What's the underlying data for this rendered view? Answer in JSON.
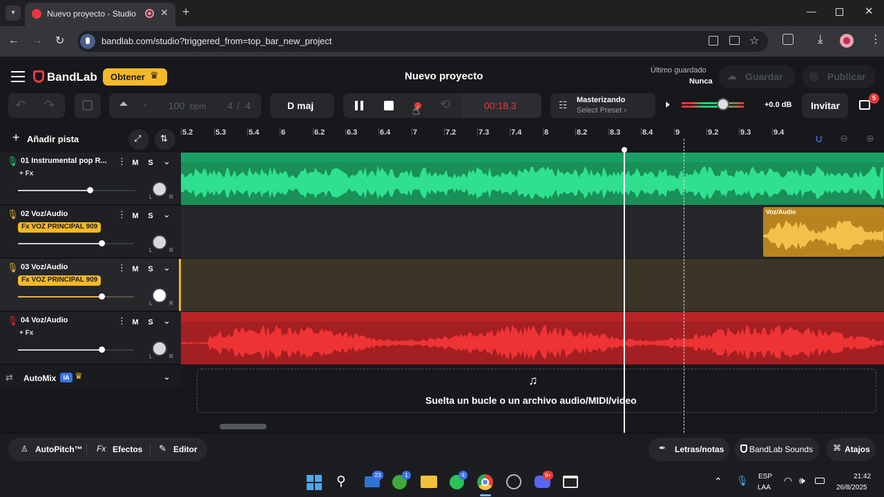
{
  "browser": {
    "tab_title": "Nuevo proyecto - Studio",
    "url": "bandlab.com/studio?triggered_from=top_bar_new_project"
  },
  "header": {
    "brand": "BandLab",
    "get_label": "Obtener",
    "project_title": "Nuevo proyecto",
    "last_saved_label": "Último guardado",
    "last_saved_value": "Nunca",
    "save_label": "Guardar",
    "publish_label": "Publicar"
  },
  "toolbar": {
    "bpm_value": "100",
    "bpm_unit": "bpm",
    "time_sig_num": "4",
    "time_sig_sep": "/",
    "time_sig_den": "4",
    "key": "D maj",
    "time": "00:18.3",
    "mastering_title": "Masterizando",
    "mastering_preset": "Select Preset ›",
    "volume_db": "+0.0 dB",
    "invite_label": "Invitar",
    "gift_badge": "5"
  },
  "sidebar": {
    "add_track_label": "Añadir pista"
  },
  "ruler": {
    "ticks": [
      "5.2",
      "5.3",
      "5.4",
      "6",
      "6.2",
      "6.3",
      "6.4",
      "7",
      "7.2",
      "7.3",
      "7.4",
      "8",
      "8.2",
      "8.3",
      "8.4",
      "9",
      "9.2",
      "9.3",
      "9.4"
    ]
  },
  "tracks": [
    {
      "name": "01  Instrumental pop R...",
      "fx": "+ Fx",
      "m": "M",
      "s": "S",
      "l": "L",
      "r": "R"
    },
    {
      "name": "02  Voz/Audio",
      "fx": "Fx VOZ PRINCIPAL 909",
      "m": "M",
      "s": "S",
      "l": "L",
      "r": "R",
      "clip_label": "Voz/Audio"
    },
    {
      "name": "03  Voz/Audio",
      "fx": "Fx VOZ PRINCIPAL 909",
      "m": "M",
      "s": "S",
      "l": "L",
      "r": "R"
    },
    {
      "name": "04  Voz/Audio",
      "fx": "+ Fx",
      "m": "M",
      "s": "S",
      "l": "L",
      "r": "R"
    }
  ],
  "automix": {
    "label": "AutoMix",
    "badge": "IA"
  },
  "dropzone": {
    "text": "Suelta un bucle o un archivo audio/MIDI/video"
  },
  "bottombar": {
    "autopitch": "AutoPitch™",
    "effects": "Efectos",
    "editor": "Editor",
    "lyrics": "Letras/notas",
    "sounds": "BandLab Sounds",
    "shortcuts": "Atajos"
  },
  "taskbar": {
    "mail_badge": "23",
    "xbox_badge": "1",
    "whatsapp_badge": "4",
    "discord_badge": "9+",
    "lang": "ESP",
    "lang_sub": "LAA",
    "clock_time": "21:42",
    "clock_date": "26/8/2025"
  },
  "colors": {
    "accent_yellow": "#f5b829",
    "track1_green": "#1fd07a",
    "track2_yellow": "#f2b22e",
    "track4_red": "#e0282a",
    "time_red": "#e53838"
  }
}
